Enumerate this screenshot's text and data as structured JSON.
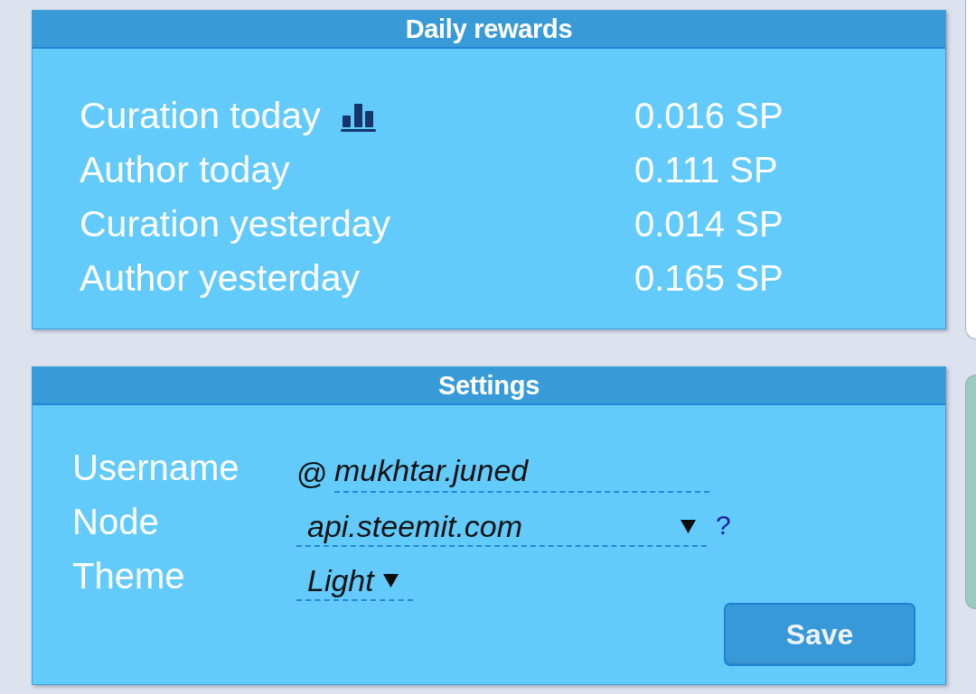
{
  "rewards": {
    "title": "Daily rewards",
    "rows": [
      {
        "label": "Curation today",
        "value": "0.016 SP",
        "chart_link": true
      },
      {
        "label": "Author today",
        "value": "0.111 SP",
        "chart_link": false
      },
      {
        "label": "Curation yesterday",
        "value": "0.014 SP",
        "chart_link": false
      },
      {
        "label": "Author yesterday",
        "value": "0.165 SP",
        "chart_link": false
      }
    ]
  },
  "settings": {
    "title": "Settings",
    "fields": [
      {
        "kind": "text",
        "label": "Username",
        "prefix": "@",
        "value": "mukhtar.juned"
      },
      {
        "kind": "select",
        "label": "Node",
        "value": "api.steemit.com",
        "help": "?"
      },
      {
        "kind": "compact-select",
        "label": "Theme",
        "value": "Light"
      }
    ],
    "save_button": "Save"
  }
}
